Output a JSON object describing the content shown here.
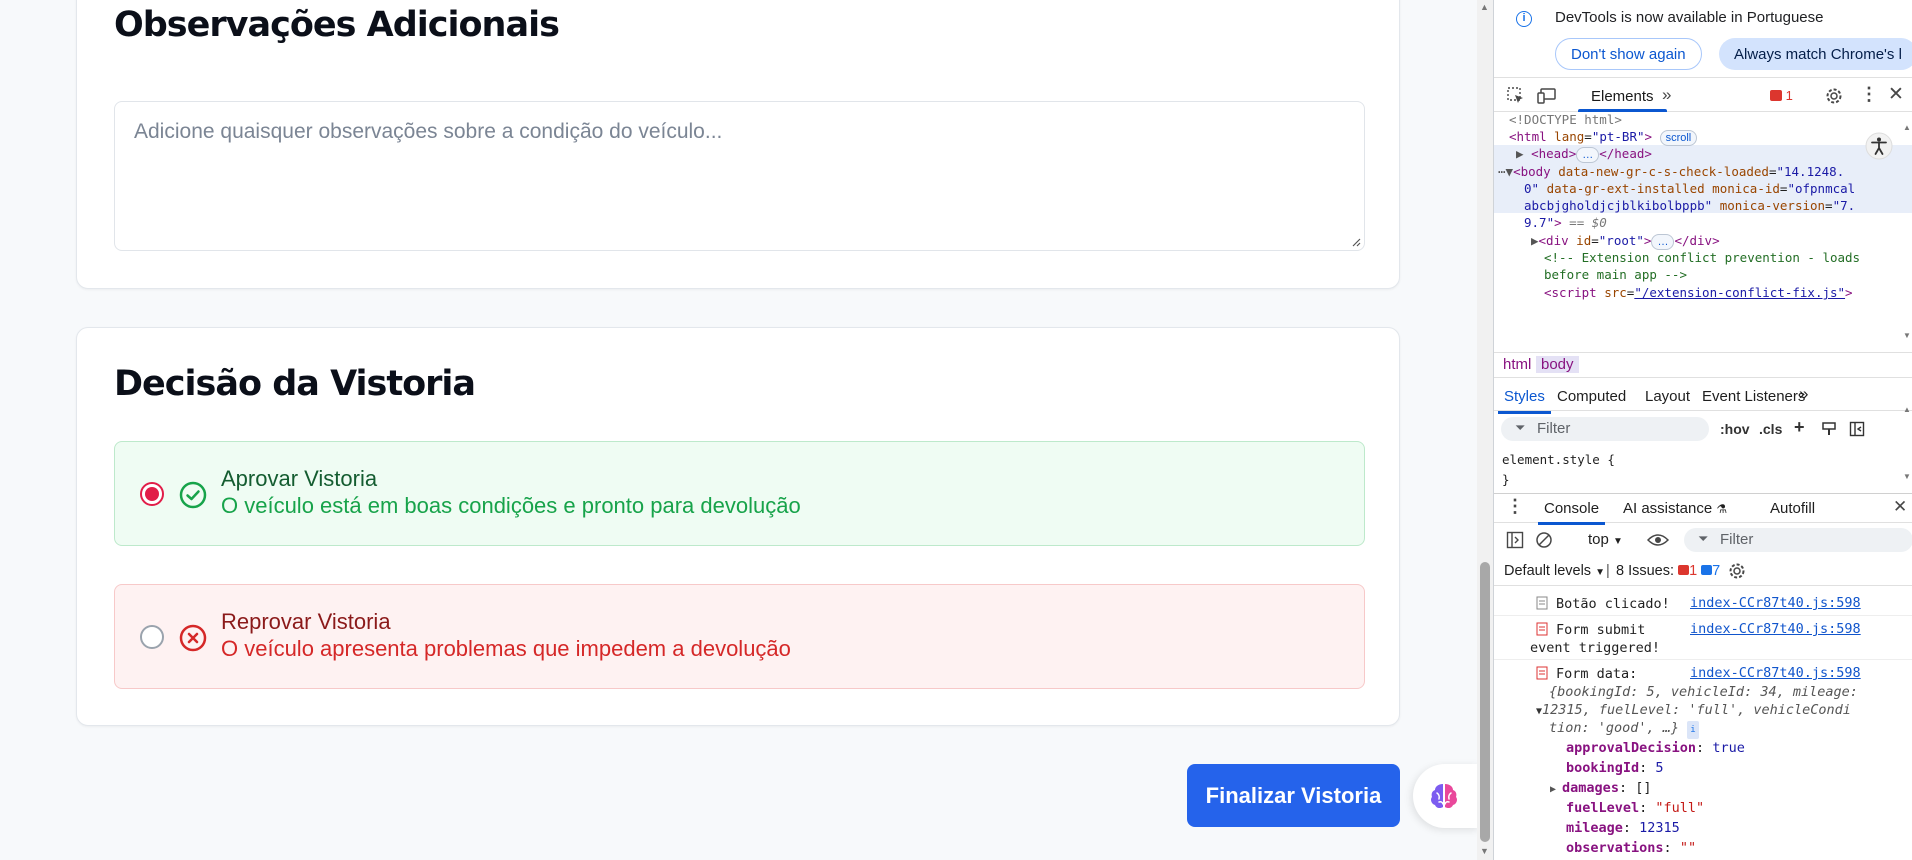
{
  "app": {
    "observations": {
      "title": "Observações Adicionais",
      "placeholder": "Adicione quaisquer observações sobre a condição do veículo..."
    },
    "decision": {
      "title": "Decisão da Vistoria",
      "approve": {
        "title": "Aprovar Vistoria",
        "desc": "O veículo está em boas condições e pronto para devolução",
        "selected": true
      },
      "reject": {
        "title": "Reprovar Vistoria",
        "desc": "O veículo apresenta problemas que impedem a devolução",
        "selected": false
      }
    },
    "finalize_label": "Finalizar Vistoria",
    "colors": {
      "primary": "#2563eb",
      "approve": "#17a34a",
      "reject": "#d52828",
      "radio_checked": "#e11d48"
    }
  },
  "devtools": {
    "infobar": {
      "message": "DevTools is now available in Portuguese",
      "dont_show": "Don't show again",
      "always_match": "Always match Chrome's l"
    },
    "tabs": {
      "elements": "Elements",
      "error_count": "1"
    },
    "dom": {
      "doctype": "<!DOCTYPE html>",
      "html_open": "<html",
      "html_lang_attr": "lang",
      "html_lang_val": "\"pt-BR\"",
      "html_close": ">",
      "scroll_badge": "scroll",
      "head": "<head>",
      "head_end": "</head>",
      "body_open": "<body",
      "body_attr1": "data-new-gr-c-s-check-loaded",
      "body_val1a": "\"14.1248.",
      "body_val1b": "0\"",
      "body_attr2": "data-gr-ext-installed",
      "body_attr3": "monica-id",
      "body_val3a": "\"ofpnmcal",
      "body_val3b": "abcbjgholdjcjblkibolbppb\"",
      "body_attr4": "monica-version",
      "body_val4a": "\"7.",
      "body_val4b": "9.7\"",
      "body_close": ">",
      "eq": "== $0",
      "div_open": "<div",
      "div_attr": "id",
      "div_val": "\"root\"",
      "div_close": ">",
      "div_end": "</div>",
      "comment1": "<!-- Extension conflict prevention - loads",
      "comment2": "before main app -->",
      "script_open": "<script",
      "script_attr": "src",
      "script_val": "\"/extension-conflict-fix.js\"",
      "script_close": ">",
      "ellipsis": "…"
    },
    "breadcrumbs": [
      "html",
      "body"
    ],
    "styles_tabs": [
      "Styles",
      "Computed",
      "Layout",
      "Event Listeners"
    ],
    "filter_placeholder": "Filter",
    "hov": ":hov",
    "cls": ".cls",
    "element_style": "element.style {",
    "element_style_close": "}",
    "console_tabs": [
      "Console",
      "AI assistance",
      "Autofill"
    ],
    "console_context": "top",
    "console_filter": "Filter",
    "default_levels": "Default levels",
    "issues_label": "8 Issues:",
    "issues_errors": "1",
    "issues_info": "7",
    "logs": [
      {
        "text": "Botão clicado!",
        "src": "index-CCr87t40.js:598"
      },
      {
        "text": "Form submit",
        "text2": "event triggered!",
        "src": "index-CCr87t40.js:598"
      },
      {
        "text": "Form data:",
        "src": "index-CCr87t40.js:598"
      }
    ],
    "object_preview": {
      "line1": "{bookingId: 5, vehicleId: 34, mileage:",
      "line2": "12315, fuelLevel: 'full', vehicleCondi",
      "line3": "tion: 'good', …}"
    },
    "object_props": [
      {
        "key": "approvalDecision",
        "value": "true",
        "type": "n"
      },
      {
        "key": "bookingId",
        "value": "5",
        "type": "n"
      },
      {
        "key": "damages",
        "value": "[]",
        "type": "plain"
      },
      {
        "key": "fuelLevel",
        "value": "\"full\"",
        "type": "s"
      },
      {
        "key": "mileage",
        "value": "12315",
        "type": "n"
      },
      {
        "key": "observations",
        "value": "\"\"",
        "type": "s"
      }
    ]
  }
}
